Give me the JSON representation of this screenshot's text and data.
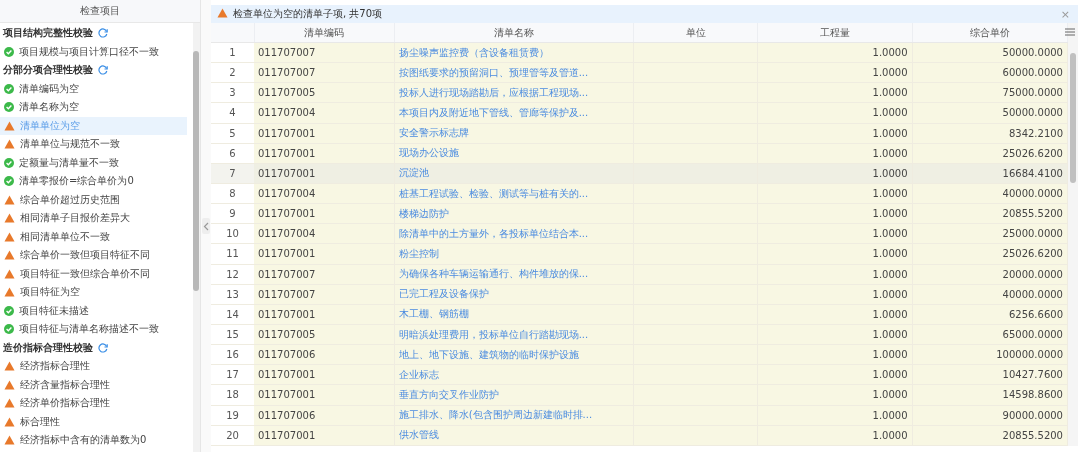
{
  "sidebar": {
    "title": "检查项目",
    "groups": [
      {
        "title": "项目结构完整性校验",
        "items": [
          {
            "label": "项目规模与项目计算口径不一致",
            "warning": false,
            "selected": false
          }
        ]
      },
      {
        "title": "分部分项合理性校验",
        "items": [
          {
            "label": "清单编码为空",
            "warning": false,
            "selected": false
          },
          {
            "label": "清单名称为空",
            "warning": false,
            "selected": false
          },
          {
            "label": "清单单位为空",
            "warning": true,
            "selected": true
          },
          {
            "label": "清单单位与规范不一致",
            "warning": true,
            "selected": false
          },
          {
            "label": "定额量与清单量不一致",
            "warning": false,
            "selected": false
          },
          {
            "label": "清单零报价=综合单价为0",
            "warning": false,
            "selected": false
          },
          {
            "label": "综合单价超过历史范围",
            "warning": true,
            "selected": false
          },
          {
            "label": "相同清单子目报价差异大",
            "warning": true,
            "selected": false
          },
          {
            "label": "相同清单单位不一致",
            "warning": true,
            "selected": false
          },
          {
            "label": "综合单价一致但项目特征不同",
            "warning": true,
            "selected": false
          },
          {
            "label": "项目特征一致但综合单价不同",
            "warning": true,
            "selected": false
          },
          {
            "label": "项目特征为空",
            "warning": true,
            "selected": false
          },
          {
            "label": "项目特征未描述",
            "warning": false,
            "selected": false
          },
          {
            "label": "项目特征与清单名称描述不一致",
            "warning": false,
            "selected": false
          }
        ]
      },
      {
        "title": "造价指标合理性校验",
        "items": [
          {
            "label": "经济指标合理性",
            "warning": true,
            "selected": false
          },
          {
            "label": "经济含量指标合理性",
            "warning": true,
            "selected": false
          },
          {
            "label": "经济单价指标合理性",
            "warning": true,
            "selected": false
          },
          {
            "label": "标合理性",
            "warning": true,
            "selected": false
          },
          {
            "label": "经济指标中含有的清单数为0",
            "warning": true,
            "selected": false
          }
        ]
      }
    ]
  },
  "result": {
    "title": "检查单位为空的清单子项, 共70项",
    "close": "×",
    "table": {
      "columns": [
        "",
        "清单编码",
        "清单名称",
        "单位",
        "工程量",
        "综合单价"
      ],
      "rows": [
        {
          "cells": [
            "1",
            "011707007",
            "扬尘噪声监控费（含设备租赁费）",
            "",
            "1.0000",
            "50000.0000"
          ],
          "selected": false
        },
        {
          "cells": [
            "2",
            "011707007",
            "按图纸要求的预留洞口、预埋管等及管道...",
            "",
            "1.0000",
            "60000.0000"
          ],
          "selected": false
        },
        {
          "cells": [
            "3",
            "011707005",
            "投标人进行现场踏勘后，应根据工程现场...",
            "",
            "1.0000",
            "75000.0000"
          ],
          "selected": false
        },
        {
          "cells": [
            "4",
            "011707004",
            "本项目内及附近地下管线、管廊等保护及...",
            "",
            "1.0000",
            "50000.0000"
          ],
          "selected": false
        },
        {
          "cells": [
            "5",
            "011707001",
            "安全警示标志牌",
            "",
            "1.0000",
            "8342.2100"
          ],
          "selected": false
        },
        {
          "cells": [
            "6",
            "011707001",
            "现场办公设施",
            "",
            "1.0000",
            "25026.6200"
          ],
          "selected": false
        },
        {
          "cells": [
            "7",
            "011707001",
            "沉淀池",
            "",
            "1.0000",
            "16684.4100"
          ],
          "selected": true
        },
        {
          "cells": [
            "8",
            "011707004",
            "桩基工程试验、检验、测试等与桩有关的...",
            "",
            "1.0000",
            "40000.0000"
          ],
          "selected": false
        },
        {
          "cells": [
            "9",
            "011707001",
            "楼梯边防护",
            "",
            "1.0000",
            "20855.5200"
          ],
          "selected": false
        },
        {
          "cells": [
            "10",
            "011707004",
            "除清单中的土方量外，各投标单位结合本...",
            "",
            "1.0000",
            "25000.0000"
          ],
          "selected": false
        },
        {
          "cells": [
            "11",
            "011707001",
            "粉尘控制",
            "",
            "1.0000",
            "25026.6200"
          ],
          "selected": false
        },
        {
          "cells": [
            "12",
            "011707007",
            "为确保各种车辆运输通行、构件堆放的保...",
            "",
            "1.0000",
            "20000.0000"
          ],
          "selected": false
        },
        {
          "cells": [
            "13",
            "011707007",
            "已完工程及设备保护",
            "",
            "1.0000",
            "40000.0000"
          ],
          "selected": false
        },
        {
          "cells": [
            "14",
            "011707001",
            "木工棚、钢筋棚",
            "",
            "1.0000",
            "6256.6600"
          ],
          "selected": false
        },
        {
          "cells": [
            "15",
            "011707005",
            "明暗浜处理费用，投标单位自行踏勘现场...",
            "",
            "1.0000",
            "65000.0000"
          ],
          "selected": false
        },
        {
          "cells": [
            "16",
            "011707006",
            "地上、地下设施、建筑物的临时保护设施",
            "",
            "1.0000",
            "100000.0000"
          ],
          "selected": false
        },
        {
          "cells": [
            "17",
            "011707001",
            "企业标志",
            "",
            "1.0000",
            "10427.7600"
          ],
          "selected": false
        },
        {
          "cells": [
            "18",
            "011707001",
            "垂直方向交叉作业防护",
            "",
            "1.0000",
            "14598.8600"
          ],
          "selected": false
        },
        {
          "cells": [
            "19",
            "011707006",
            "施工排水、降水(包含围护周边新建临时排...",
            "",
            "1.0000",
            "90000.0000"
          ],
          "selected": false
        },
        {
          "cells": [
            "20",
            "011707001",
            "供水管线",
            "",
            "1.0000",
            "20855.5200"
          ],
          "selected": false
        }
      ]
    }
  }
}
